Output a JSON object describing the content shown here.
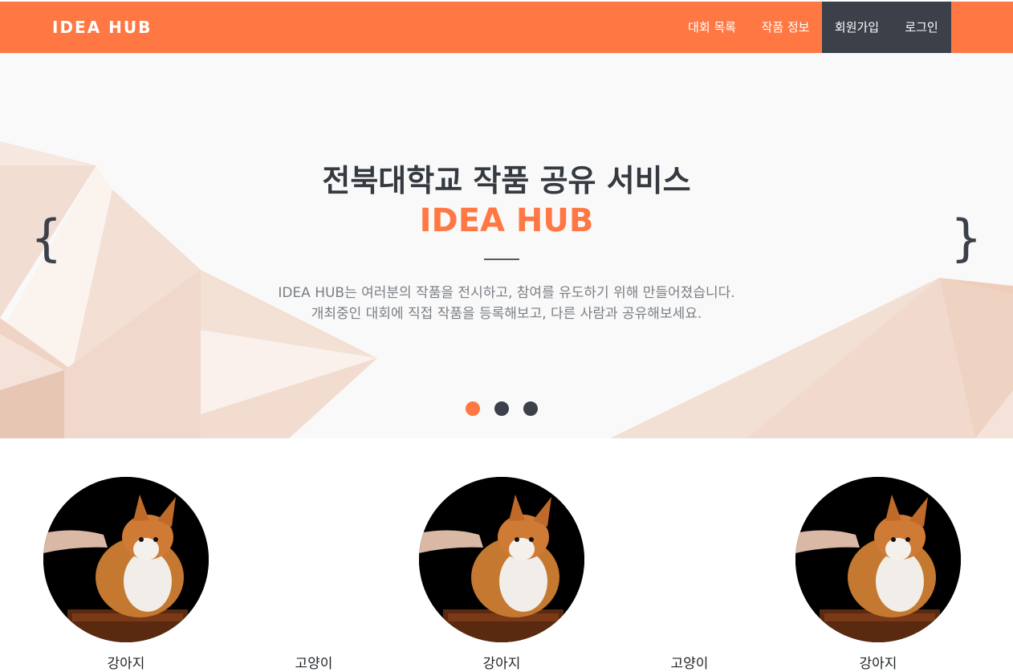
{
  "navbar": {
    "brand": "IDEA HUB",
    "links": [
      {
        "label": "대회 목록"
      },
      {
        "label": "작품 정보"
      },
      {
        "label": "회원가입"
      },
      {
        "label": "로그인"
      }
    ],
    "colors": {
      "primary": "#ff7843",
      "dark": "#3b4049"
    }
  },
  "hero": {
    "title": "전북대학교 작품 공유 서비스",
    "brand": "IDEA HUB",
    "desc_line1": "IDEA HUB는 여러분의 작품을 전시하고, 참여를 유도하기 위해 만들어졌습니다.",
    "desc_line2": "개최중인 대회에 직접 작품을 등록해보고, 다른 사람과 공유해보세요.",
    "prev_arrow": "{",
    "next_arrow": "}",
    "slides": 3,
    "active_slide": 1
  },
  "cards": [
    {
      "image": "corgi-photo",
      "caption": "강아지"
    },
    {
      "image": "corgi-photo",
      "caption": "강아지"
    },
    {
      "image": "corgi-photo",
      "caption": "강아지"
    }
  ],
  "mid_captions": [
    {
      "caption": "고양이"
    },
    {
      "caption": "고양이"
    }
  ]
}
